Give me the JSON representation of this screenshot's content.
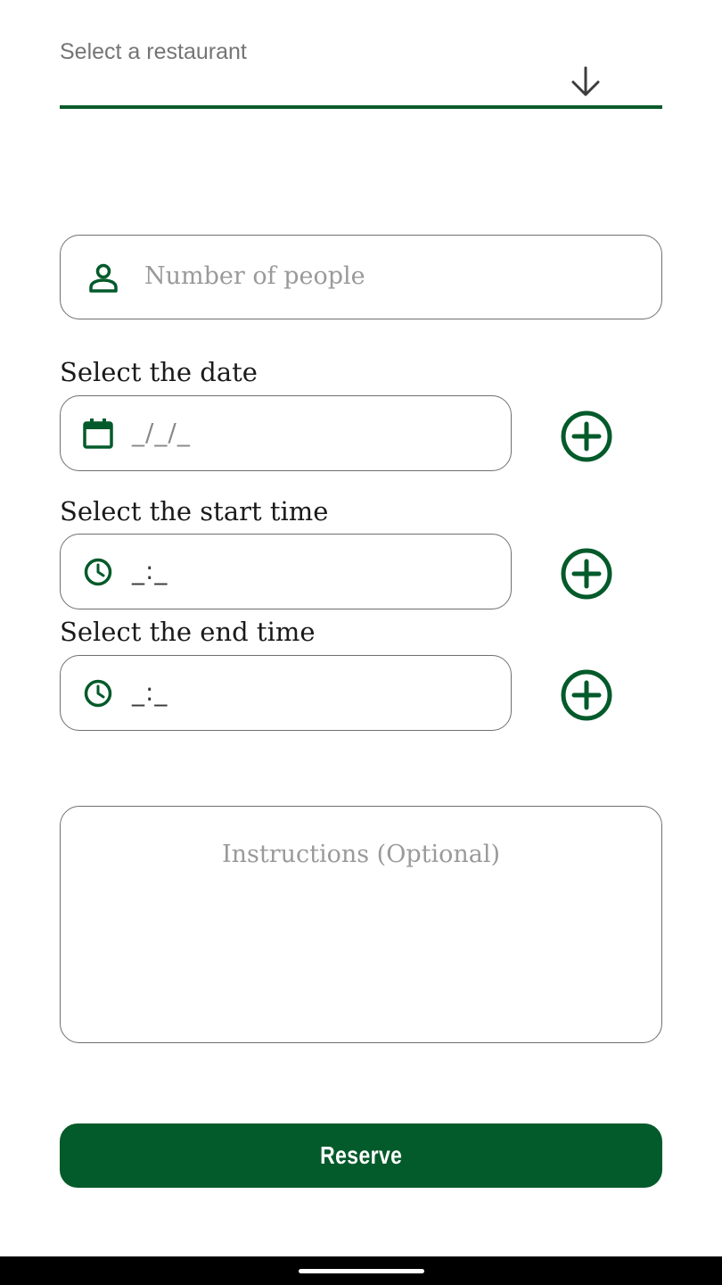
{
  "restaurant_select": {
    "placeholder": "Select a restaurant",
    "icon": "arrow-down-icon"
  },
  "people": {
    "placeholder": "Number of people",
    "icon": "person-icon"
  },
  "date": {
    "label": "Select the date",
    "value": "_/_/_",
    "icon": "calendar-icon"
  },
  "start_time": {
    "label": "Select the start time",
    "value": "_:_",
    "icon": "clock-icon"
  },
  "end_time": {
    "label": "Select the end time",
    "value": "_:_",
    "icon": "clock-icon"
  },
  "instructions": {
    "placeholder": "Instructions (Optional)"
  },
  "reserve": {
    "label": "Reserve"
  },
  "colors": {
    "accent": "#035a2a",
    "outline": "#6f6f6f",
    "placeholder": "#9a9a9a"
  }
}
